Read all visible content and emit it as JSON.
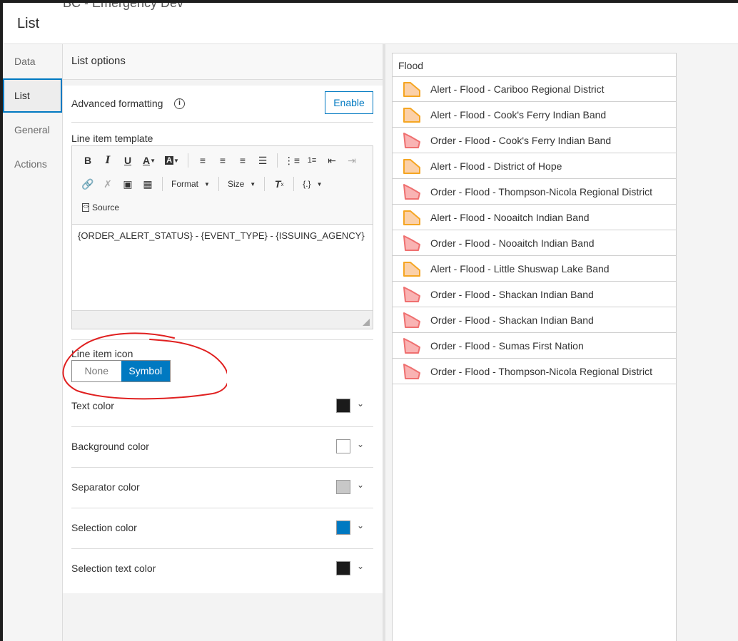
{
  "window": {
    "background_title": "BC - Emergency Dev",
    "title": "List"
  },
  "nav": {
    "items": [
      {
        "label": "Data"
      },
      {
        "label": "List"
      },
      {
        "label": "General"
      },
      {
        "label": "Actions"
      }
    ],
    "active": "List"
  },
  "settings": {
    "header": "List options",
    "advanced_formatting_label": "Advanced formatting",
    "enable_label": "Enable",
    "line_item_template_label": "Line item template",
    "toolbar": {
      "format_label": "Format",
      "size_label": "Size",
      "expression_label": "{.}",
      "source_label": "Source"
    },
    "template_text": "{ORDER_ALERT_STATUS} - {EVENT_TYPE} - {ISSUING_AGENCY}",
    "line_item_icon_label": "Line item icon",
    "icon_options": {
      "none": "None",
      "symbol": "Symbol",
      "selected": "Symbol"
    },
    "colors": {
      "text_color": {
        "label": "Text color",
        "value": "#1b1b1b"
      },
      "background_color": {
        "label": "Background color",
        "value": "#ffffff"
      },
      "separator_color": {
        "label": "Separator color",
        "value": "#c8c8c8"
      },
      "selection_color": {
        "label": "Selection color",
        "value": "#0079c1"
      },
      "selection_text_color": {
        "label": "Selection text color",
        "value": "#1b1b1b"
      }
    },
    "accent": "#0079c1",
    "annotation_color": "#e02020"
  },
  "preview": {
    "list_title": "Flood",
    "alert_symbol": {
      "fill": "#fbd0a8",
      "stroke": "#f5a623"
    },
    "order_symbol": {
      "fill": "#f9b3b3",
      "stroke": "#ef7070"
    },
    "items": [
      {
        "text": "Alert - Flood - Cariboo Regional District",
        "type": "alert"
      },
      {
        "text": "Alert - Flood - Cook's Ferry Indian Band",
        "type": "alert"
      },
      {
        "text": "Order - Flood - Cook's Ferry Indian Band",
        "type": "order"
      },
      {
        "text": "Alert - Flood - District of Hope",
        "type": "alert"
      },
      {
        "text": "Order - Flood - Thompson-Nicola Regional District",
        "type": "order"
      },
      {
        "text": "Alert - Flood - Nooaitch Indian Band",
        "type": "alert"
      },
      {
        "text": "Order - Flood - Nooaitch Indian Band",
        "type": "order"
      },
      {
        "text": "Alert - Flood - Little Shuswap Lake Band",
        "type": "alert"
      },
      {
        "text": "Order - Flood - Shackan Indian Band",
        "type": "order"
      },
      {
        "text": "Order - Flood - Shackan Indian Band",
        "type": "order"
      },
      {
        "text": "Order - Flood - Sumas First Nation",
        "type": "order"
      },
      {
        "text": "Order - Flood - Thompson-Nicola Regional District",
        "type": "order"
      }
    ]
  }
}
